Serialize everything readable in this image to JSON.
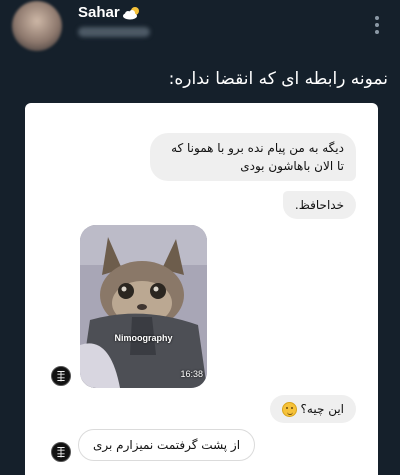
{
  "post": {
    "author_name": "Sahar",
    "author_emoji_icon": "sun-behind-cloud-icon",
    "text": "نمونه رابطه ای که انقضا نداره:"
  },
  "chat": {
    "messages": [
      {
        "side": "right",
        "text": "دیگه به من پیام نده برو با همونا که تا الان باهاشون بودی"
      },
      {
        "side": "right",
        "text": "خداحافظ."
      },
      {
        "side": "left",
        "type": "photo",
        "watermark": "Nimoography",
        "time": "16:38"
      },
      {
        "side": "right",
        "text": "این چیه؟",
        "emoji": "smiling-face-icon"
      },
      {
        "side": "left",
        "text": "از پشت گرفتمت نمیزارم بری"
      }
    ]
  },
  "icons": [
    "more-options-icon",
    "profile-stamp-icon"
  ],
  "colors": {
    "background": "#15202b",
    "bubble": "#efefef",
    "card": "#ffffff"
  }
}
